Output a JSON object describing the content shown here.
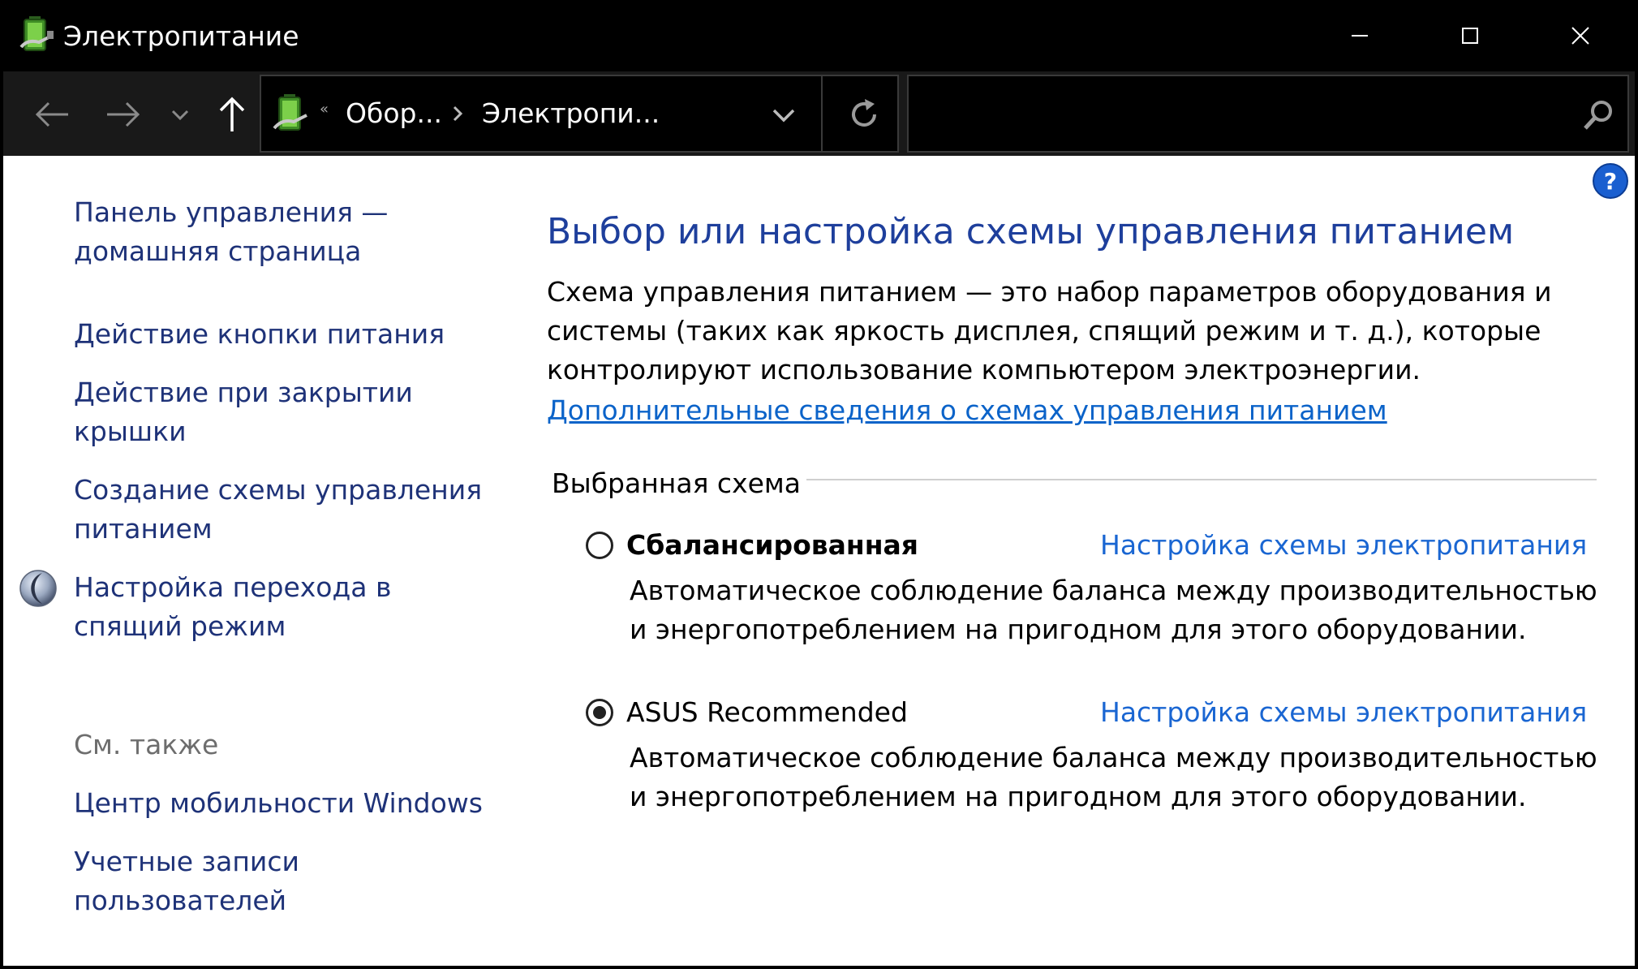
{
  "window": {
    "title": "Электропитание",
    "min_icon": "minimize-icon",
    "max_icon": "maximize-icon",
    "close_icon": "close-icon"
  },
  "nav": {
    "breadcrumb": [
      "Обор...",
      "Электропи..."
    ],
    "search_placeholder": ""
  },
  "sidebar": {
    "home_link": "Панель управления — домашняя страница",
    "items": [
      {
        "label": "Действие кнопки питания"
      },
      {
        "label": "Действие при закрытии крышки"
      },
      {
        "label": "Создание схемы управления питанием"
      },
      {
        "label": "Настройка перехода в спящий режим",
        "icon": "moon-icon"
      }
    ],
    "see_also_label": "См. также",
    "see_also": [
      {
        "label": "Центр мобильности Windows"
      },
      {
        "label": "Учетные записи пользователей"
      }
    ]
  },
  "main": {
    "title": "Выбор или настройка схемы управления питанием",
    "description": "Схема управления питанием — это набор параметров оборудования и системы (таких как яркость дисплея, спящий режим и т. д.), которые контролируют использование компьютером электроэнергии.",
    "more_link": "Дополнительные сведения о схемах управления питанием",
    "group_label": "Выбранная схема",
    "plans": [
      {
        "name": "Сбалансированная",
        "selected": false,
        "link": "Настройка схемы электропитания",
        "description": "Автоматическое соблюдение баланса между производительностью и энергопотреблением на пригодном для этого оборудовании."
      },
      {
        "name": "ASUS Recommended",
        "selected": true,
        "link": "Настройка схемы электропитания",
        "description": "Автоматическое соблюдение баланса между производительностью и энергопотреблением на пригодном для этого оборудовании."
      }
    ]
  },
  "colors": {
    "title_blue": "#1e3f9c",
    "link_blue": "#1a66d2",
    "sidebar_link": "#1e3278",
    "titlebar_bg": "#000000",
    "navbar_bg": "#191919"
  }
}
